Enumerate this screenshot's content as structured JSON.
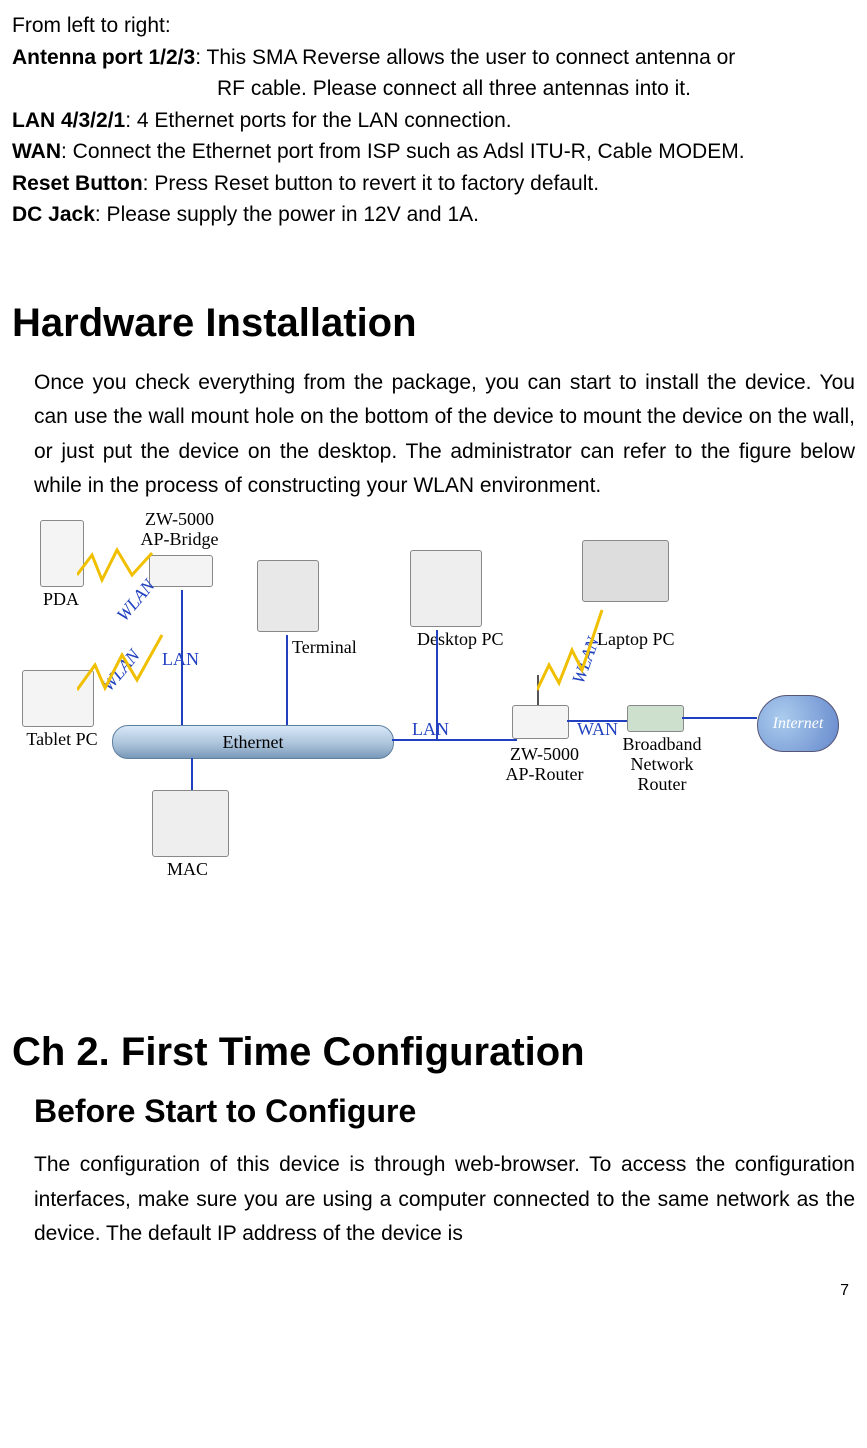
{
  "intro": "From left to right:",
  "defs": {
    "antenna": {
      "label": "Antenna port 1/2/3",
      "text1": ": This SMA Reverse allows the user to connect antenna or",
      "text2": "RF cable. Please connect all three antennas into it."
    },
    "lan": {
      "label": "LAN 4/3/2/1",
      "text": ": 4 Ethernet ports for the LAN connection."
    },
    "wan": {
      "label": "WAN",
      "text": ": Connect the Ethernet port from ISP such as Adsl ITU-R, Cable MODEM."
    },
    "reset": {
      "label": "Reset Button",
      "text": ": Press Reset button to revert it to factory default."
    },
    "dc": {
      "label": "DC Jack",
      "text": ": Please supply the power in 12V and 1A."
    }
  },
  "hw_heading": "Hardware Installation",
  "hw_para": "Once you check everything from the package, you can start to install the device. You can use the wall mount hole on the bottom of the device to mount the device on the wall, or just put the device on the desktop. The administrator can refer to the figure below while in the process of constructing your WLAN environment.",
  "diagram": {
    "zw_bridge": "ZW-5000\nAP-Bridge",
    "pda": "PDA",
    "wlan": "WLAN",
    "tablet": "Tablet PC",
    "lan": "LAN",
    "terminal": "Terminal",
    "ethernet": "Ethernet",
    "mac": "MAC",
    "desktop": "Desktop PC",
    "zw_router": "ZW-5000\nAP-Router",
    "laptop": "Laptop PC",
    "wan": "WAN",
    "broadband": "Broadband\nNetwork\nRouter",
    "internet": "Internet"
  },
  "ch2_heading": "Ch 2. First Time Configuration",
  "before_heading": "Before Start to Configure",
  "config_para": "The configuration of this device is through web-browser. To access the configuration interfaces, make sure you are using a computer connected to the same network as the device. The default IP address of the device is",
  "page_number": "7"
}
